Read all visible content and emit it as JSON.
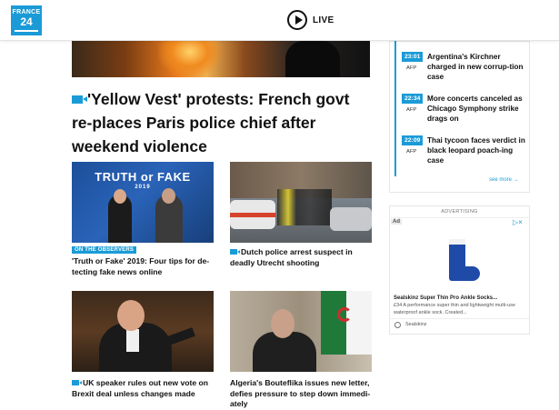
{
  "header": {
    "logo": {
      "line1": "FRANCE",
      "line2": "24"
    },
    "live_label": "LIVE"
  },
  "main": {
    "headline": "'Yellow Vest' protests: French govt re-places Paris police chief after weekend violence",
    "cards": [
      {
        "tag": "ON THE OBSERVERS",
        "title": "'Truth or Fake' 2019: Four tips for de-tecting fake news online",
        "image_text": {
          "line1": "TRUTH or FAKE",
          "line2": "2019"
        }
      },
      {
        "title": "Dutch police arrest suspect in deadly Utrecht shooting",
        "video": true
      },
      {
        "title": "UK speaker rules out new vote on Brexit deal unless changes made",
        "video": true
      },
      {
        "title": "Algeria's Bouteflika issues new letter, defies pressure to step down immedi-ately"
      }
    ]
  },
  "sidebar": {
    "news": [
      {
        "time": "23:01",
        "source": "AFP",
        "text": "Argentina's Kirchner charged in new corrup-tion case"
      },
      {
        "time": "22:34",
        "source": "AFP",
        "text": "More concerts canceled as Chicago Symphony strike drags on"
      },
      {
        "time": "22:09",
        "source": "AFP",
        "text": "Thai tycoon faces verdict in black leopard poach-ing case"
      }
    ],
    "see_more": "see more →"
  },
  "ad": {
    "label": "ADVERTISING",
    "badge": "Ad",
    "choices_icon": "▷×",
    "title": "Sealskinz Super Thin Pro Ankle Socks...",
    "description": "£34 A performance super thin and lightweight multi-use waterproof ankle sock. Created...",
    "source": "Sealskinz"
  },
  "colors": {
    "accent": "#1a9bd7",
    "text": "#111111"
  }
}
